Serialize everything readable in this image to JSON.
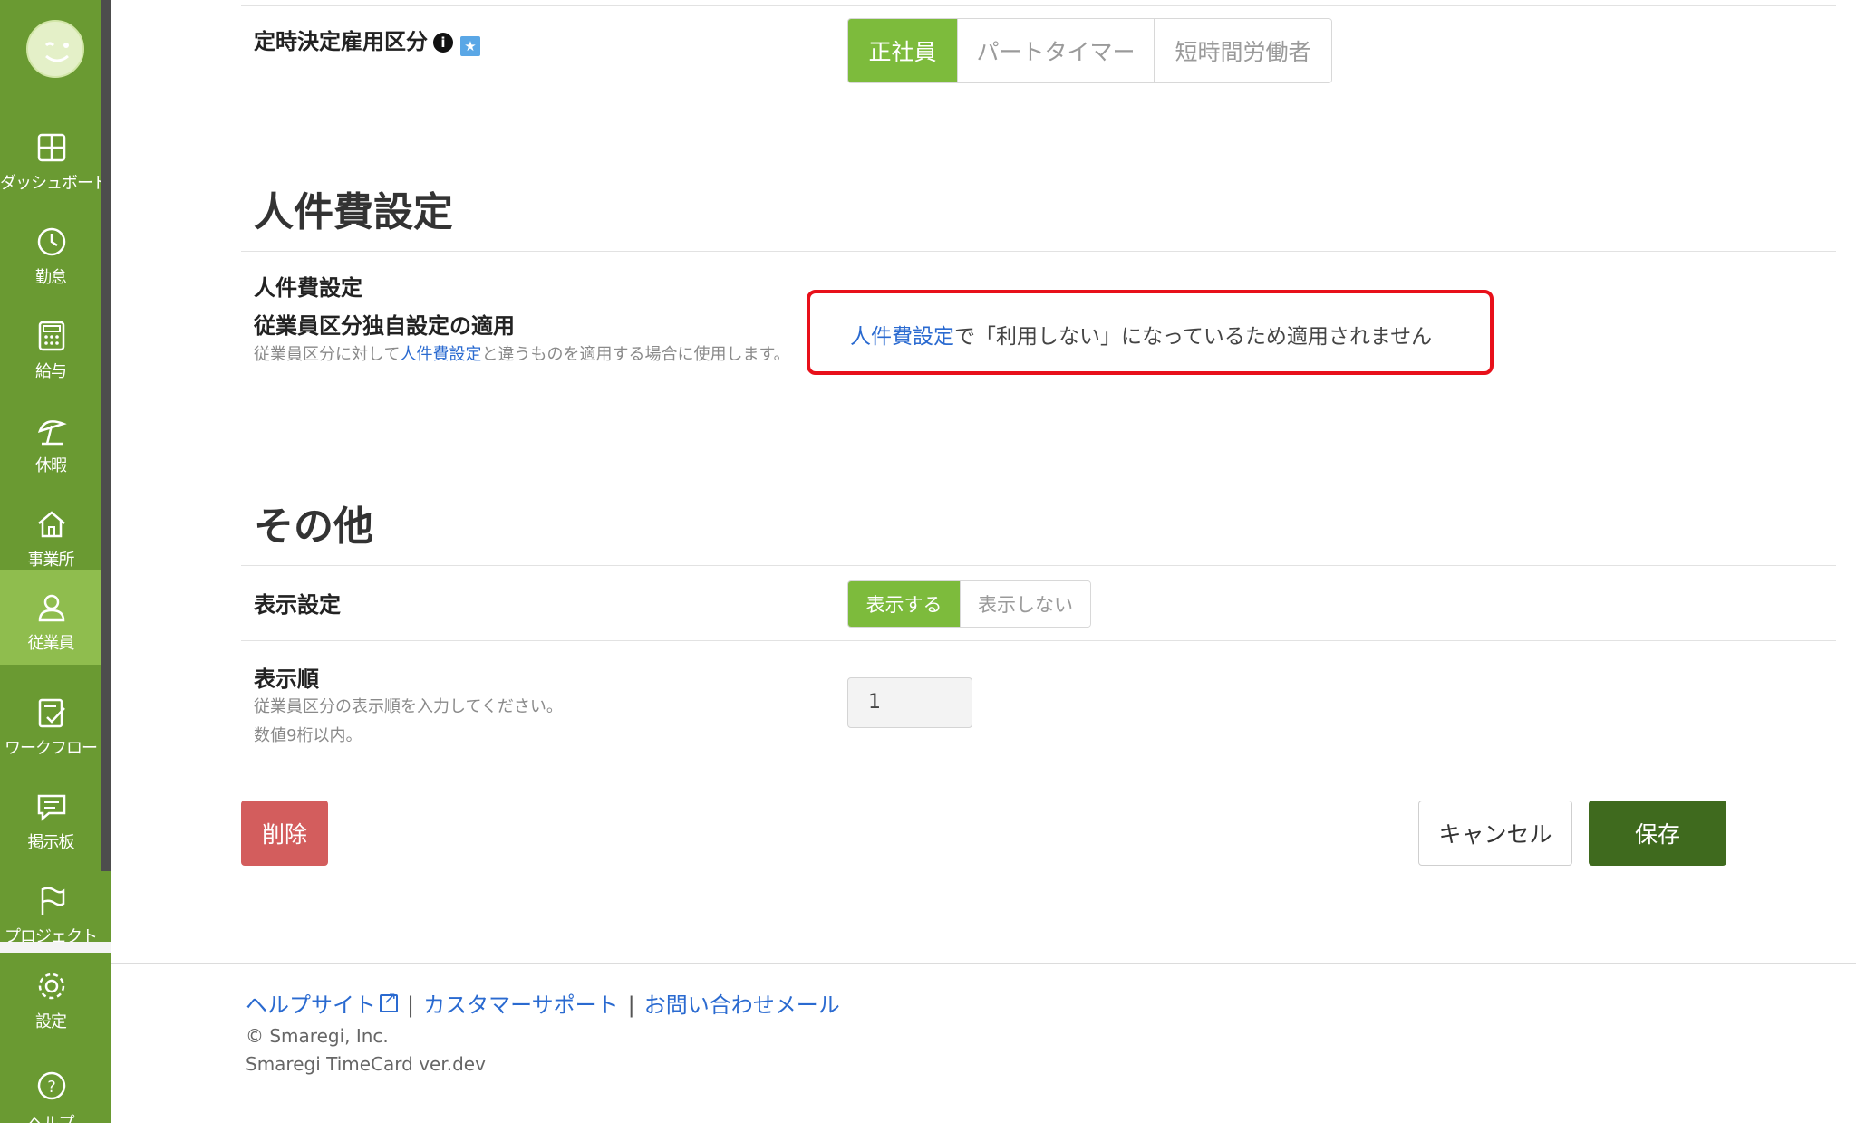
{
  "sidebar": {
    "items": [
      {
        "label": "ダッシュボード",
        "icon": "dashboard-icon"
      },
      {
        "label": "勤怠",
        "icon": "clock-icon"
      },
      {
        "label": "給与",
        "icon": "calculator-icon"
      },
      {
        "label": "休暇",
        "icon": "parasol-icon"
      },
      {
        "label": "事業所",
        "icon": "home-icon"
      },
      {
        "label": "従業員",
        "icon": "person-icon",
        "active": true
      },
      {
        "label": "ワークフロー",
        "icon": "clipboard-check-icon"
      },
      {
        "label": "掲示板",
        "icon": "chat-icon"
      },
      {
        "label": "プロジェクト",
        "icon": "flag-icon"
      }
    ],
    "bottom_items": [
      {
        "label": "設定",
        "icon": "gear-icon"
      },
      {
        "label": "ヘルプ",
        "icon": "help-icon"
      }
    ]
  },
  "fixed_employment": {
    "label": "定時決定雇用区分",
    "options": [
      "正社員",
      "パートタイマー",
      "短時間労働者"
    ],
    "selected": "正社員"
  },
  "labor_cost": {
    "section_title": "人件費設定",
    "field_label_1": "人件費設定",
    "field_label_2": "従業員区分独自設定の適用",
    "help_prefix": "従業員区分に対して",
    "help_link": "人件費設定",
    "help_suffix": "と違うものを適用する場合に使用します。",
    "notice_link": "人件費設定",
    "notice_text": "で「利用しない」になっているため適用されません"
  },
  "other": {
    "section_title": "その他",
    "display_label": "表示設定",
    "display_options": [
      "表示する",
      "表示しない"
    ],
    "display_selected": "表示する",
    "order_label": "表示順",
    "order_help_1": "従業員区分の表示順を入力してください。",
    "order_help_2": "数値9桁以内。",
    "order_value": "1"
  },
  "buttons": {
    "delete": "削除",
    "cancel": "キャンセル",
    "save": "保存"
  },
  "footer": {
    "help_site": "ヘルプサイト",
    "support": "カスタマーサポート",
    "contact": "お問い合わせメール",
    "separator": "|",
    "copyright": "© Smaregi, Inc.",
    "version": "Smaregi TimeCard ver.dev"
  },
  "colors": {
    "sidebar": "#6a9a32",
    "sidebar_active": "#8fbd4e",
    "accent": "#7dbb3c",
    "save": "#3f6a1e",
    "delete": "#d35d5d",
    "notice_border": "#e8101a",
    "link": "#2a6ad0"
  }
}
